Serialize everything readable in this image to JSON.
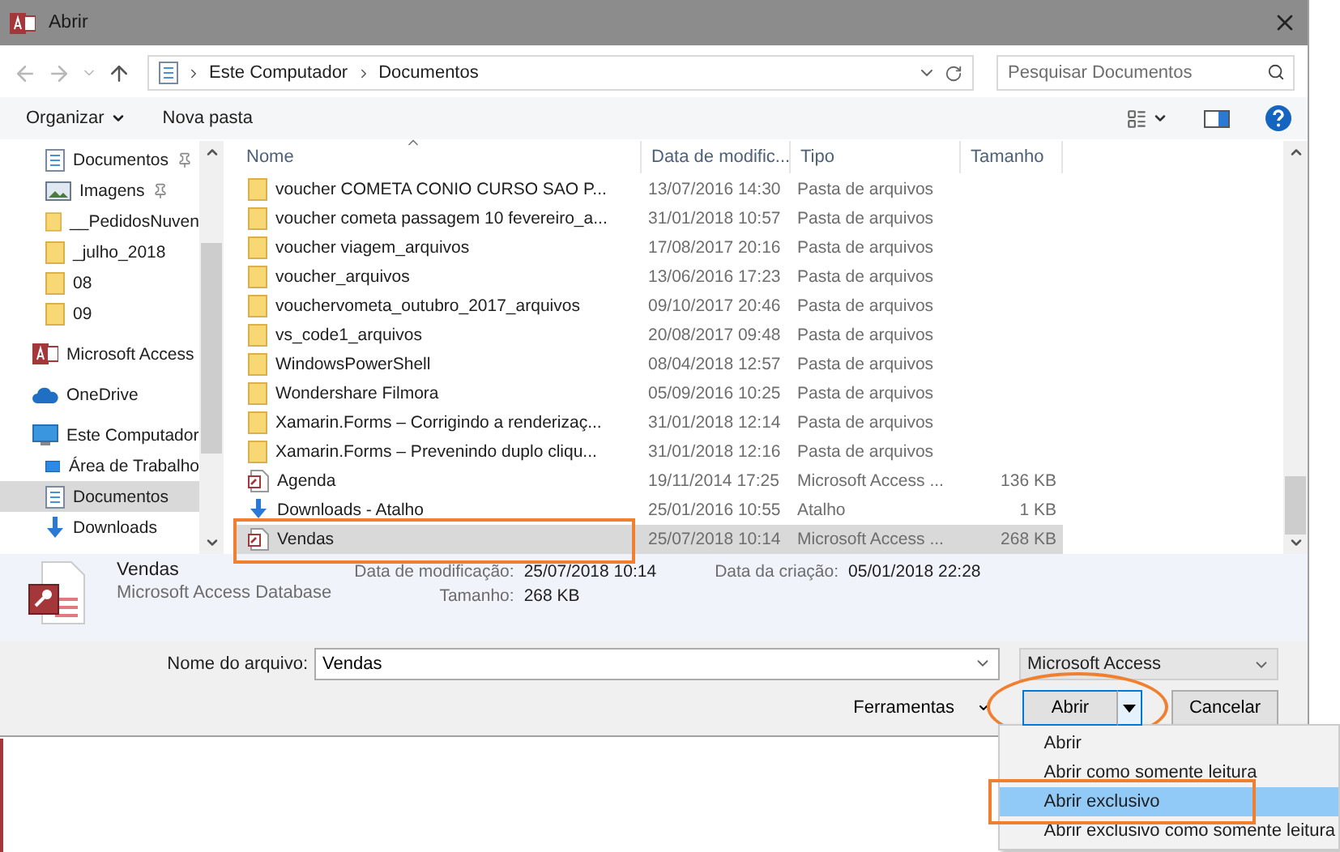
{
  "window": {
    "title": "Abrir"
  },
  "address": {
    "crumbs": [
      "Este Computador",
      "Documentos"
    ]
  },
  "search": {
    "placeholder": "Pesquisar Documentos"
  },
  "toolbar": {
    "organize": "Organizar",
    "new_folder": "Nova pasta"
  },
  "nav": {
    "quick": [
      {
        "label": "Documentos",
        "kind": "document",
        "pinned": true,
        "selected": false
      },
      {
        "label": "Imagens",
        "kind": "picture",
        "pinned": true,
        "selected": false
      },
      {
        "label": "__PedidosNuven",
        "kind": "folder",
        "pinned": false,
        "selected": false
      },
      {
        "label": "_julho_2018",
        "kind": "folder",
        "pinned": false,
        "selected": false
      },
      {
        "label": "08",
        "kind": "folder",
        "pinned": false,
        "selected": false
      },
      {
        "label": "09",
        "kind": "folder",
        "pinned": false,
        "selected": false
      }
    ],
    "roots": [
      {
        "label": "Microsoft Access",
        "kind": "access",
        "selected": false
      },
      {
        "label": "OneDrive",
        "kind": "cloud",
        "selected": false
      },
      {
        "label": "Este Computador",
        "kind": "computer",
        "selected": false,
        "children": [
          {
            "label": "Área de Trabalho",
            "kind": "desktop",
            "selected": false
          },
          {
            "label": "Documentos",
            "kind": "document",
            "selected": true
          },
          {
            "label": "Downloads",
            "kind": "download",
            "selected": false
          }
        ]
      }
    ]
  },
  "columns": [
    "Nome",
    "Data de modific...",
    "Tipo",
    "Tamanho"
  ],
  "files": [
    {
      "name": "voucher COMETA CONIO CURSO SAO P...",
      "date": "13/07/2016 14:30",
      "type": "Pasta de arquivos",
      "kind": "folder",
      "selected": false,
      "highlighted": false
    },
    {
      "name": "voucher cometa passagem 10 fevereiro_a...",
      "date": "31/01/2018 10:57",
      "type": "Pasta de arquivos",
      "kind": "folder",
      "selected": false,
      "highlighted": false
    },
    {
      "name": "voucher viagem_arquivos",
      "date": "17/08/2017 20:16",
      "type": "Pasta de arquivos",
      "kind": "folder",
      "selected": false,
      "highlighted": false
    },
    {
      "name": "voucher_arquivos",
      "date": "13/06/2016 17:23",
      "type": "Pasta de arquivos",
      "kind": "folder",
      "selected": false,
      "highlighted": false
    },
    {
      "name": "vouchervometa_outubro_2017_arquivos",
      "date": "09/10/2017 20:46",
      "type": "Pasta de arquivos",
      "kind": "folder",
      "selected": false,
      "highlighted": false
    },
    {
      "name": "vs_code1_arquivos",
      "date": "20/08/2017 09:48",
      "type": "Pasta de arquivos",
      "kind": "folder",
      "selected": false,
      "highlighted": false
    },
    {
      "name": "WindowsPowerShell",
      "date": "08/04/2018 12:57",
      "type": "Pasta de arquivos",
      "kind": "folder",
      "selected": false,
      "highlighted": false
    },
    {
      "name": "Wondershare Filmora",
      "date": "05/09/2016 10:25",
      "type": "Pasta de arquivos",
      "kind": "folder",
      "selected": false,
      "highlighted": false
    },
    {
      "name": "Xamarin.Forms – Corrigindo a renderizaç...",
      "date": "31/01/2018 12:14",
      "type": "Pasta de arquivos",
      "kind": "folder",
      "selected": false,
      "highlighted": false
    },
    {
      "name": "Xamarin.Forms – Prevenindo duplo cliqu...",
      "date": "31/01/2018 12:16",
      "type": "Pasta de arquivos",
      "kind": "folder",
      "selected": false,
      "highlighted": false
    },
    {
      "name": "Agenda",
      "date": "19/11/2014 17:25",
      "type": "Microsoft Access ...",
      "size": "136 KB",
      "kind": "access",
      "selected": false,
      "highlighted": false
    },
    {
      "name": "Downloads - Atalho",
      "date": "25/01/2016 10:55",
      "type": "Atalho",
      "size": "1 KB",
      "kind": "shortcut",
      "selected": false,
      "highlighted": false
    },
    {
      "name": "Vendas",
      "date": "25/07/2018 10:14",
      "type": "Microsoft Access ...",
      "size": "268 KB",
      "kind": "access",
      "selected": true,
      "highlighted": true
    }
  ],
  "details": {
    "name": "Vendas",
    "type": "Microsoft Access Database",
    "fields": [
      {
        "label": "Data de modificação:",
        "value": "25/07/2018 10:14"
      },
      {
        "label": "Tamanho:",
        "value": "268 KB"
      },
      {
        "label": "Data da criação:",
        "value": "05/01/2018 22:28"
      }
    ]
  },
  "filename": {
    "label": "Nome do arquivo:",
    "value": "Vendas"
  },
  "filter": {
    "value": "Microsoft Access"
  },
  "tools": {
    "label": "Ferramentas"
  },
  "open_button": {
    "label": "Abrir",
    "circled": true
  },
  "cancel_button": {
    "label": "Cancelar"
  },
  "open_menu": [
    {
      "label": "Abrir",
      "selected": false,
      "highlighted": false
    },
    {
      "label": "Abrir como somente leitura",
      "selected": false,
      "highlighted": false
    },
    {
      "label": "Abrir exclusivo",
      "selected": true,
      "highlighted": true
    },
    {
      "label": "Abrir exclusivo como somente leitura",
      "selected": false,
      "highlighted": false
    }
  ]
}
